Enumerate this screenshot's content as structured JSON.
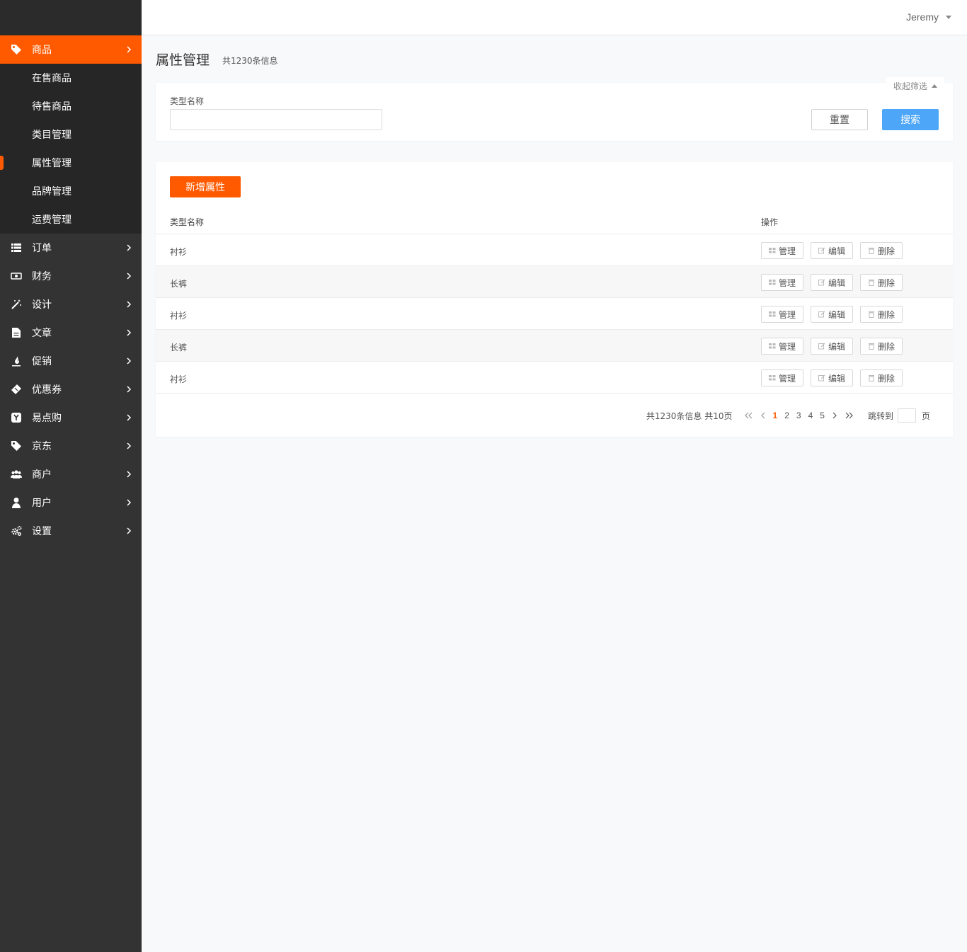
{
  "header": {
    "user_name": "Jeremy"
  },
  "sidebar": {
    "items": [
      {
        "label": "商品",
        "icon": "tag-icon",
        "active": true
      },
      {
        "label": "订单",
        "icon": "list-icon"
      },
      {
        "label": "财务",
        "icon": "money-icon"
      },
      {
        "label": "设计",
        "icon": "magic-wand-icon"
      },
      {
        "label": "文章",
        "icon": "document-icon"
      },
      {
        "label": "促销",
        "icon": "fire-icon"
      },
      {
        "label": "优惠券",
        "icon": "ticket-icon"
      },
      {
        "label": "易点购",
        "icon": "y-icon"
      },
      {
        "label": "京东",
        "icon": "tag-icon"
      },
      {
        "label": "商户",
        "icon": "users-icon"
      },
      {
        "label": "用户",
        "icon": "user-icon"
      },
      {
        "label": "设置",
        "icon": "gears-icon"
      }
    ],
    "subitems": [
      "在售商品",
      "待售商品",
      "类目管理",
      "属性管理",
      "品牌管理",
      "运费管理"
    ],
    "current_subitem": "属性管理"
  },
  "page": {
    "title": "属性管理",
    "count": "共1230条信息"
  },
  "filter": {
    "collapse_label": "收起筛选",
    "field_label": "类型名称",
    "field_value": "",
    "reset_label": "重置",
    "search_label": "搜索"
  },
  "table": {
    "add_label": "新增属性",
    "headers": [
      "类型名称",
      "操作"
    ],
    "rows": [
      {
        "name": "衬衫"
      },
      {
        "name": "长裤"
      },
      {
        "name": "衬衫"
      },
      {
        "name": "长裤"
      },
      {
        "name": "衬衫"
      }
    ],
    "actions": [
      "管理",
      "编辑",
      "删除"
    ]
  },
  "pagination": {
    "info": "共1230条信息 共10页",
    "pages": [
      "1",
      "2",
      "3",
      "4",
      "5"
    ],
    "current": "1",
    "jump_label": "跳转到",
    "page_suffix": "页"
  },
  "colors": {
    "accent": "#ff5a00",
    "search_button": "#4da6f7",
    "sidebar_bg": "#333333",
    "sidebar_sub_bg": "#262626"
  }
}
